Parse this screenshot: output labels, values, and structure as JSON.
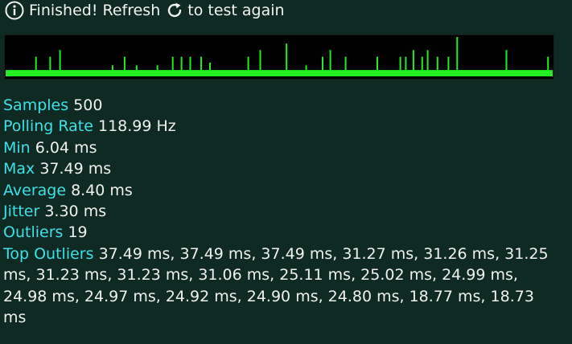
{
  "status": {
    "before_icon": "Finished! Refresh",
    "after_icon": "to test again",
    "info_icon": "info-circle-icon",
    "refresh_icon": "refresh-icon"
  },
  "colors": {
    "background": "#0f2a22",
    "label": "#3de0e6",
    "graph_bar": "#22ee22",
    "graph_bg": "#000000"
  },
  "graph": {
    "baseline_ms": 6.04,
    "max_ms": 37.49,
    "spikes": [
      {
        "sample": 27,
        "ms": 18.7
      },
      {
        "sample": 40,
        "ms": 18.7
      },
      {
        "sample": 49,
        "ms": 25.0
      },
      {
        "sample": 97,
        "ms": 10.5
      },
      {
        "sample": 108,
        "ms": 18.7
      },
      {
        "sample": 119,
        "ms": 10.5
      },
      {
        "sample": 138,
        "ms": 10.5
      },
      {
        "sample": 152,
        "ms": 18.7
      },
      {
        "sample": 160,
        "ms": 18.7
      },
      {
        "sample": 168,
        "ms": 18.7
      },
      {
        "sample": 178,
        "ms": 18.7
      },
      {
        "sample": 186,
        "ms": 13.0
      },
      {
        "sample": 221,
        "ms": 18.7
      },
      {
        "sample": 232,
        "ms": 25.0
      },
      {
        "sample": 256,
        "ms": 31.2
      },
      {
        "sample": 274,
        "ms": 10.5
      },
      {
        "sample": 289,
        "ms": 18.7
      },
      {
        "sample": 296,
        "ms": 25.0
      },
      {
        "sample": 310,
        "ms": 18.7
      },
      {
        "sample": 339,
        "ms": 18.7
      },
      {
        "sample": 360,
        "ms": 18.7
      },
      {
        "sample": 365,
        "ms": 18.7
      },
      {
        "sample": 372,
        "ms": 25.0
      },
      {
        "sample": 380,
        "ms": 18.7
      },
      {
        "sample": 385,
        "ms": 25.0
      },
      {
        "sample": 394,
        "ms": 18.7
      },
      {
        "sample": 404,
        "ms": 18.7
      },
      {
        "sample": 412,
        "ms": 37.49
      },
      {
        "sample": 457,
        "ms": 25.0
      },
      {
        "sample": 495,
        "ms": 18.7
      }
    ]
  },
  "stats": {
    "samples": {
      "label": "Samples",
      "value": "500"
    },
    "polling_rate": {
      "label": "Polling Rate",
      "value": "118.99 Hz"
    },
    "min": {
      "label": "Min",
      "value": "6.04 ms"
    },
    "max": {
      "label": "Max",
      "value": "37.49 ms"
    },
    "average": {
      "label": "Average",
      "value": "8.40 ms"
    },
    "jitter": {
      "label": "Jitter",
      "value": "3.30 ms"
    },
    "outliers": {
      "label": "Outliers",
      "value": "19"
    },
    "top_outliers": {
      "label": "Top Outliers",
      "value": "37.49 ms, 37.49 ms, 37.49 ms, 31.27 ms, 31.26 ms, 31.25 ms, 31.23 ms, 31.23 ms, 31.06 ms, 25.11 ms, 25.02 ms, 24.99 ms, 24.98 ms, 24.97 ms, 24.92 ms, 24.90 ms, 24.80 ms, 18.77 ms, 18.73 ms"
    }
  }
}
